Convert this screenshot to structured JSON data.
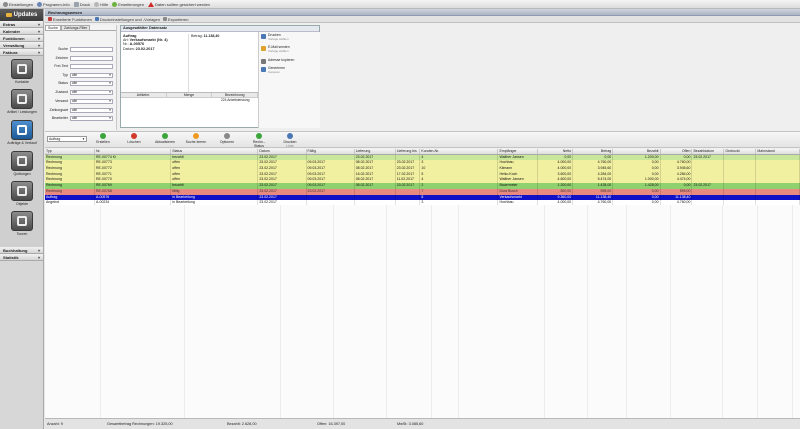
{
  "topbar": {
    "items": [
      {
        "label": "Einstellungen",
        "icon": "gear-icon"
      },
      {
        "label": "Programm-Info",
        "icon": "info-icon"
      },
      {
        "label": "Druck",
        "icon": "print-icon"
      },
      {
        "label": "Hilfe",
        "icon": "help-icon"
      },
      {
        "label": "Erweiterungen",
        "icon": "plus-icon"
      },
      {
        "label": "Daten sollten gesichert werden",
        "icon": "warning-icon"
      }
    ]
  },
  "sidebar": {
    "updates_label": "Updates",
    "sections": [
      "Extras",
      "Kalender",
      "Funktionen",
      "Verwaltung",
      "Faktura"
    ],
    "tiles": [
      {
        "label": "Kontakte"
      },
      {
        "label": "Artikel / Leistungen"
      },
      {
        "label": "Aufträge & Verkauf"
      },
      {
        "label": "Quittungen"
      },
      {
        "label": "Objekte"
      },
      {
        "label": "Touren"
      }
    ],
    "bottom_sections": [
      "Buchhaltung",
      "Statistik"
    ]
  },
  "main": {
    "breadcrumb": "Rechnungswesen",
    "subbar": [
      {
        "label": "Erweiterte Funktionen",
        "icon": "list-icon"
      },
      {
        "label": "Druckeinstellungen und -Vorlagen",
        "icon": "printer-settings-icon"
      },
      {
        "label": "Exportieren",
        "icon": "export-icon"
      }
    ]
  },
  "search": {
    "tabs": [
      "Suche",
      "Zahlungs-Filter"
    ],
    "fields": [
      {
        "label": "Suche",
        "value": ""
      },
      {
        "label": "Zeichen",
        "value": ""
      },
      {
        "label": "Frei-Text",
        "value": ""
      },
      {
        "label": "Typ",
        "value": "alle"
      },
      {
        "label": "Status",
        "value": "alle"
      },
      {
        "label": "Zustand",
        "value": "alle"
      },
      {
        "label": "Versand",
        "value": "alle"
      },
      {
        "label": "Zahlungsart",
        "value": "alle"
      },
      {
        "label": "Bearbeiter",
        "value": "alle"
      }
    ]
  },
  "card": {
    "title": "Ausgewählter Datensatz",
    "type": "Auftrag",
    "art_label": "Art:",
    "art_value": "Verkaufsmarkt (Nr. 4)",
    "nr_label": "Nr.:",
    "nr_value": "A-00576",
    "datum_label": "Datum:",
    "datum_value": "23.02.2017",
    "betrag_label": "Betrag:",
    "betrag_value": "11.138,40",
    "table_headers": [
      "Artikelnr.",
      "Menge",
      "Bezeichnung"
    ],
    "table_row": [
      "",
      "",
      "224 Arbeitsleistung"
    ],
    "actions": [
      {
        "label": "Drucken",
        "sub": "Vorlage wählen",
        "icon": "print-icon"
      },
      {
        "label": "E-Mail senden",
        "sub": "Vorlage wählen",
        "icon": "mail-icon"
      },
      {
        "label": "Adresse kopieren",
        "sub": "",
        "icon": "copy-icon"
      },
      {
        "label": "Generieren",
        "sub": "Kopieren",
        "icon": "generate-icon"
      }
    ]
  },
  "actions": {
    "type_select": "Auftrag",
    "buttons": [
      {
        "label": "Erstellen",
        "icon": "add-icon",
        "color": "#3ba53b"
      },
      {
        "label": "Löschen",
        "icon": "delete-icon",
        "color": "#d33a2c"
      },
      {
        "label": "Aktualisieren",
        "icon": "refresh-icon",
        "color": "#3ba53b"
      },
      {
        "label": "Suche leeren",
        "icon": "clear-search-icon",
        "color": "#f09a25"
      },
      {
        "label": "Optionen",
        "icon": "wrench-icon",
        "color": "#888888"
      },
      {
        "label": "Rechn.-Status",
        "icon": "checkmark-icon",
        "color": "#3ba53b"
      },
      {
        "label": "Drucken",
        "icon": "print-icon",
        "color": "#4a78b5",
        "sub": "Liste"
      }
    ]
  },
  "grid": {
    "headers": [
      "Typ",
      "Nr.",
      "Status",
      "Datum",
      "Fällig",
      "Lieferung",
      "Lieferung bis",
      "Kunden-Nr.",
      "Empfänger",
      "Netto",
      "Betrag",
      "Bezahlt",
      "Offen",
      "Bezahldatum",
      "Gedruckt",
      "Mahnstand"
    ],
    "rows": [
      {
        "bg": "#c9e79a",
        "fg": "#111111",
        "cells": [
          "Rechnung",
          "RE-00774 Ki",
          "bezahlt",
          "23.02.2017",
          "",
          "23.02.2017",
          "",
          "4",
          "Walther Jansen",
          "0,00",
          "0,00",
          "1.200,00",
          "0,00",
          "23.02.2017",
          "",
          ""
        ]
      },
      {
        "bg": "#f1f0a0",
        "fg": "#111111",
        "cells": [
          "Rechnung",
          "RE-00773",
          "offen",
          "23.02.2017",
          "09.03.2017",
          "08.02.2017",
          "23.02.2017",
          "3",
          "Hochbau",
          "4.000,00",
          "4.760,00",
          "0,00",
          "4.760,00",
          "",
          "",
          ""
        ]
      },
      {
        "bg": "#f1f0a0",
        "fg": "#111111",
        "cells": [
          "Rechnung",
          "RE-00772",
          "offen",
          "23.02.2017",
          "09.03.2017",
          "08.02.2017",
          "23.02.2017",
          "10",
          "Klimann",
          "4.000,00",
          "3.945,60",
          "0,00",
          "3.945,60",
          "",
          "",
          ""
        ]
      },
      {
        "bg": "#f1f0a0",
        "fg": "#111111",
        "cells": [
          "Rechnung",
          "RE-00771",
          "offen",
          "23.02.2017",
          "09.03.2017",
          "16.02.2017",
          "17.02.2017",
          "5",
          "Heiko Koch",
          "3.600,00",
          "4.284,00",
          "0,00",
          "4.284,00",
          "",
          "",
          ""
        ]
      },
      {
        "bg": "#f1f0a0",
        "fg": "#111111",
        "cells": [
          "Rechnung",
          "RE-00770",
          "offen",
          "23.02.2017",
          "09.03.2017",
          "08.02.2017",
          "11.02.2017",
          "4",
          "Walther Jansen",
          "4.600,00",
          "5.474,00",
          "1.000,00",
          "4.474,00",
          "",
          "",
          ""
        ]
      },
      {
        "bg": "#8fd16e",
        "fg": "#111111",
        "cells": [
          "Rechnung",
          "RE-00769",
          "bezahlt",
          "23.02.2017",
          "09.03.2017",
          "08.02.2017",
          "23.02.2017",
          "2",
          "Bauermeier",
          "1.200,00",
          "1.428,00",
          "1.428,00",
          "0,00",
          "23.02.2017",
          "",
          ""
        ]
      },
      {
        "bg": "#e88a80",
        "fg": "#333333",
        "cells": [
          "Rechnung",
          "RE-00768",
          "fällig",
          "23.02.2017",
          "23.02.2017",
          "",
          "",
          "7",
          "Dora Busch",
          "500,00",
          "595,00",
          "0,00",
          "595,00",
          "",
          "",
          ""
        ]
      },
      {
        "bg": "#1010c8",
        "fg": "#ffffff",
        "cells": [
          "Auftrag",
          "A-00576",
          "in Bearbeitung",
          "23.02.2017",
          "",
          "",
          "",
          "8",
          "Verkaufsmarkt",
          "9.360,00",
          "11.138,40",
          "0,00",
          "11.138,40",
          "",
          "",
          ""
        ]
      },
      {
        "bg": "#ffffff",
        "fg": "#111111",
        "cells": [
          "Angebot",
          "A-00234",
          "in Bearbeitung",
          "23.02.2017",
          "",
          "",
          "",
          "3",
          "Hochbau",
          "4.000,00",
          "4.760,00",
          "0,00",
          "4.760,00",
          "",
          "",
          ""
        ]
      }
    ]
  },
  "statusbar": {
    "anzahl": "Anzahl: 9",
    "gesamt": "Gesamtbetrag Rechnungen: 19.325,00",
    "bezahlt": "Bezahlt: 2.628,00",
    "offen": "Offen: 16.397,00",
    "mwst": "MwSt: 3.085,60"
  }
}
